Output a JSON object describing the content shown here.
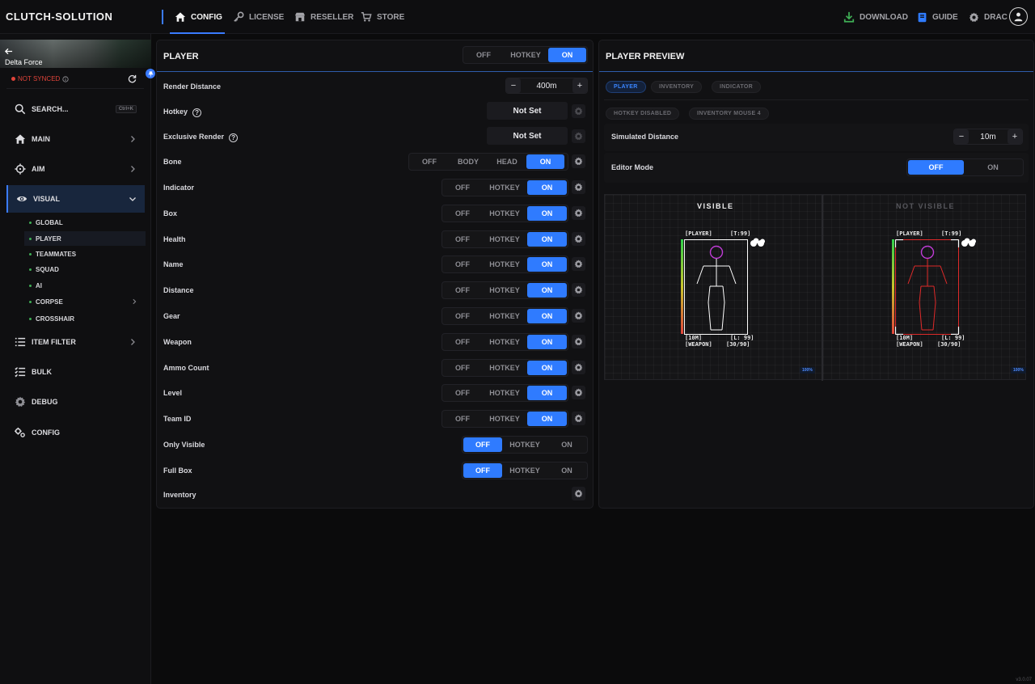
{
  "app": {
    "brand": "CLUTCH-SOLUTION",
    "version": "v3.0.07"
  },
  "nav": {
    "tabs": [
      {
        "label": "CONFIG",
        "icon": "home-icon"
      },
      {
        "label": "LICENSE",
        "icon": "key-icon"
      },
      {
        "label": "RESELLER",
        "icon": "store-icon"
      },
      {
        "label": "STORE",
        "icon": "cart-icon"
      }
    ],
    "download": "DOWNLOAD",
    "guide": "GUIDE",
    "user": "DRAC"
  },
  "colors": {
    "accent": "#2f7bff",
    "danger": "#e0443a",
    "ok": "#3fae55"
  },
  "sidebar": {
    "game": "Delta Force",
    "sync_status": "NOT SYNCED",
    "search_label": "SEARCH...",
    "search_shortcut": "Ctrl+K",
    "items": [
      {
        "label": "MAIN"
      },
      {
        "label": "AIM"
      },
      {
        "label": "VISUAL"
      },
      {
        "label": "ITEM FILTER"
      },
      {
        "label": "BULK"
      },
      {
        "label": "DEBUG"
      },
      {
        "label": "CONFIG"
      }
    ],
    "visual_sub": [
      {
        "label": "GLOBAL"
      },
      {
        "label": "PLAYER"
      },
      {
        "label": "TEAMMATES"
      },
      {
        "label": "SQUAD"
      },
      {
        "label": "AI"
      },
      {
        "label": "CORPSE"
      },
      {
        "label": "CROSSHAIR"
      }
    ]
  },
  "player": {
    "title": "PLAYER",
    "master_opts": [
      "OFF",
      "HOTKEY",
      "ON"
    ],
    "master_selected": "ON",
    "render_distance_label": "Render Distance",
    "render_distance_value": "400m",
    "hotkey_label": "Hotkey",
    "hotkey_value": "Not Set",
    "exclusive_label": "Exclusive Render",
    "exclusive_value": "Not Set",
    "bone_label": "Bone",
    "bone_opts": [
      "OFF",
      "BODY",
      "HEAD",
      "ON"
    ],
    "bone_selected": "ON",
    "tri_opts": [
      "OFF",
      "HOTKEY",
      "ON"
    ],
    "rows": [
      {
        "label": "Indicator",
        "selected": "ON"
      },
      {
        "label": "Box",
        "selected": "ON"
      },
      {
        "label": "Health",
        "selected": "ON"
      },
      {
        "label": "Name",
        "selected": "ON"
      },
      {
        "label": "Distance",
        "selected": "ON"
      },
      {
        "label": "Gear",
        "selected": "ON"
      },
      {
        "label": "Weapon",
        "selected": "ON"
      },
      {
        "label": "Ammo Count",
        "selected": "ON"
      },
      {
        "label": "Level",
        "selected": "ON"
      },
      {
        "label": "Team ID",
        "selected": "ON"
      }
    ],
    "only_visible_label": "Only Visible",
    "only_visible_selected": "OFF",
    "full_box_label": "Full Box",
    "full_box_selected": "OFF",
    "inventory_label": "Inventory"
  },
  "preview": {
    "title": "PLAYER PREVIEW",
    "tabs": [
      "PLAYER",
      "INVENTORY",
      "INDICATOR"
    ],
    "chips": [
      "HOTKEY DISABLED",
      "INVENTORY MOUSE 4"
    ],
    "sim_distance_label": "Simulated Distance",
    "sim_distance_value": "10m",
    "editor_label": "Editor Mode",
    "editor_opts": [
      "OFF",
      "ON"
    ],
    "editor_selected": "OFF",
    "visible_label": "VISIBLE",
    "not_visible_label": "NOT VISIBLE",
    "esp": {
      "name": "[PLAYER]",
      "team": "[T:99]",
      "distance": "[10M]",
      "level": "[L: 99]",
      "weapon": "[WEAPON]",
      "ammo": "[30/90]",
      "health_fraction": 1.0
    },
    "zoom": "100%"
  }
}
